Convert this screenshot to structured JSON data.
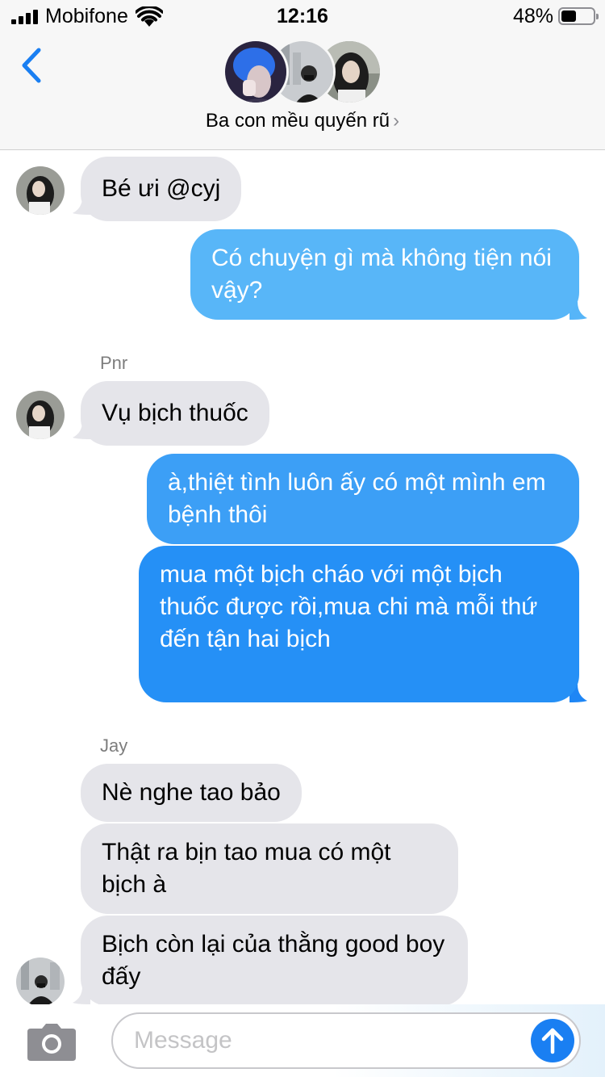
{
  "status_bar": {
    "carrier": "Mobifone",
    "time": "12:16",
    "battery_percent": "48%",
    "battery_level": 0.48
  },
  "header": {
    "group_name": "Ba con mều quyến rũ",
    "chevron": "›"
  },
  "messages": [
    {
      "direction": "in",
      "text": "Bé ưi @cyj"
    },
    {
      "direction": "out",
      "text": "Có chuyện gì mà không tiện nói vậy?"
    },
    {
      "sender": "Pnr",
      "direction": "in",
      "text": "Vụ bịch thuốc"
    },
    {
      "direction": "out",
      "text": "à,thiệt tình luôn ấy có một mình em bệnh thôi"
    },
    {
      "direction": "out",
      "text": "mua một bịch cháo với một bịch thuốc được rồi,mua chi mà mỗi thứ đến tận hai bịch"
    },
    {
      "sender": "Jay",
      "direction": "in",
      "text": "Nè nghe tao bảo"
    },
    {
      "direction": "in",
      "text": "Thật ra bịn tao mua có một bịch à"
    },
    {
      "direction": "in",
      "text": "Bịch còn lại của thằng good boy đấy"
    }
  ],
  "input": {
    "placeholder": "Message"
  },
  "colors": {
    "incoming_bubble": "#e5e5ea",
    "outgoing_bubble_light": "#5ab7f8",
    "outgoing_bubble_dark": "#1e86f5",
    "accent": "#1a7ff2"
  },
  "icons": {
    "back": "chevron-left-icon",
    "camera": "camera-icon",
    "send": "arrow-up-icon"
  }
}
